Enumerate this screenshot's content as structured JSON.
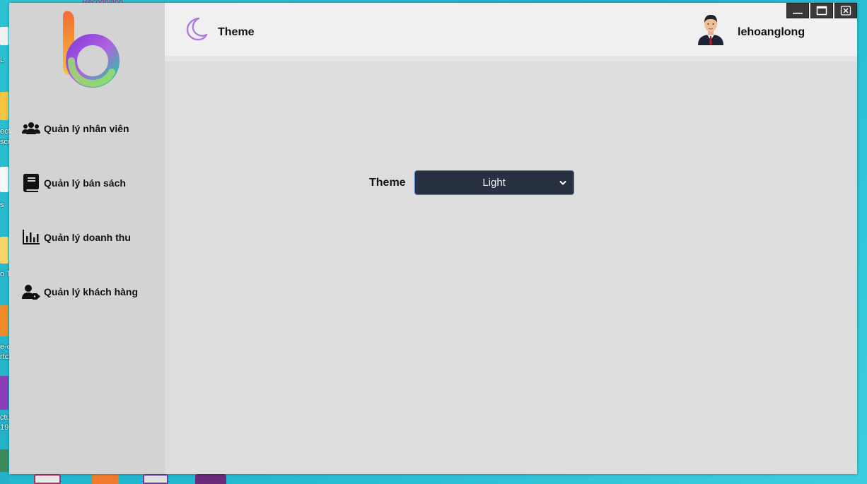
{
  "desktop": {
    "top_label": "Recognition",
    "icon_labels": [
      "L",
      "ect",
      "scu",
      "s",
      "o Te",
      "e-c",
      "rtcu",
      "ctu",
      "19"
    ]
  },
  "window": {
    "controls": {
      "minimize": "minimize-icon",
      "maximize": "maximize-icon",
      "close": "close-icon"
    }
  },
  "sidebar": {
    "logo": "brand-logo",
    "items": [
      {
        "label": "Quản lý nhân viên",
        "icon": "users-icon"
      },
      {
        "label": "Quản lý bán sách",
        "icon": "book-icon"
      },
      {
        "label": "Quản lý doanh thu",
        "icon": "bar-chart-icon"
      },
      {
        "label": "Quản lý khách hàng",
        "icon": "user-tag-icon"
      }
    ]
  },
  "header": {
    "title": "Theme",
    "icon": "moon-icon",
    "user": {
      "name": "lehoanglong",
      "avatar": "businessman-avatar"
    }
  },
  "main": {
    "theme_label": "Theme",
    "theme_select": {
      "value": "Light"
    }
  },
  "colors": {
    "accent": "#b07be0",
    "select_background": "#283142",
    "select_border": "#4a78c9",
    "sidebar": "#d3d3d3",
    "content": "#dddddd",
    "header": "#f0f0f0"
  }
}
